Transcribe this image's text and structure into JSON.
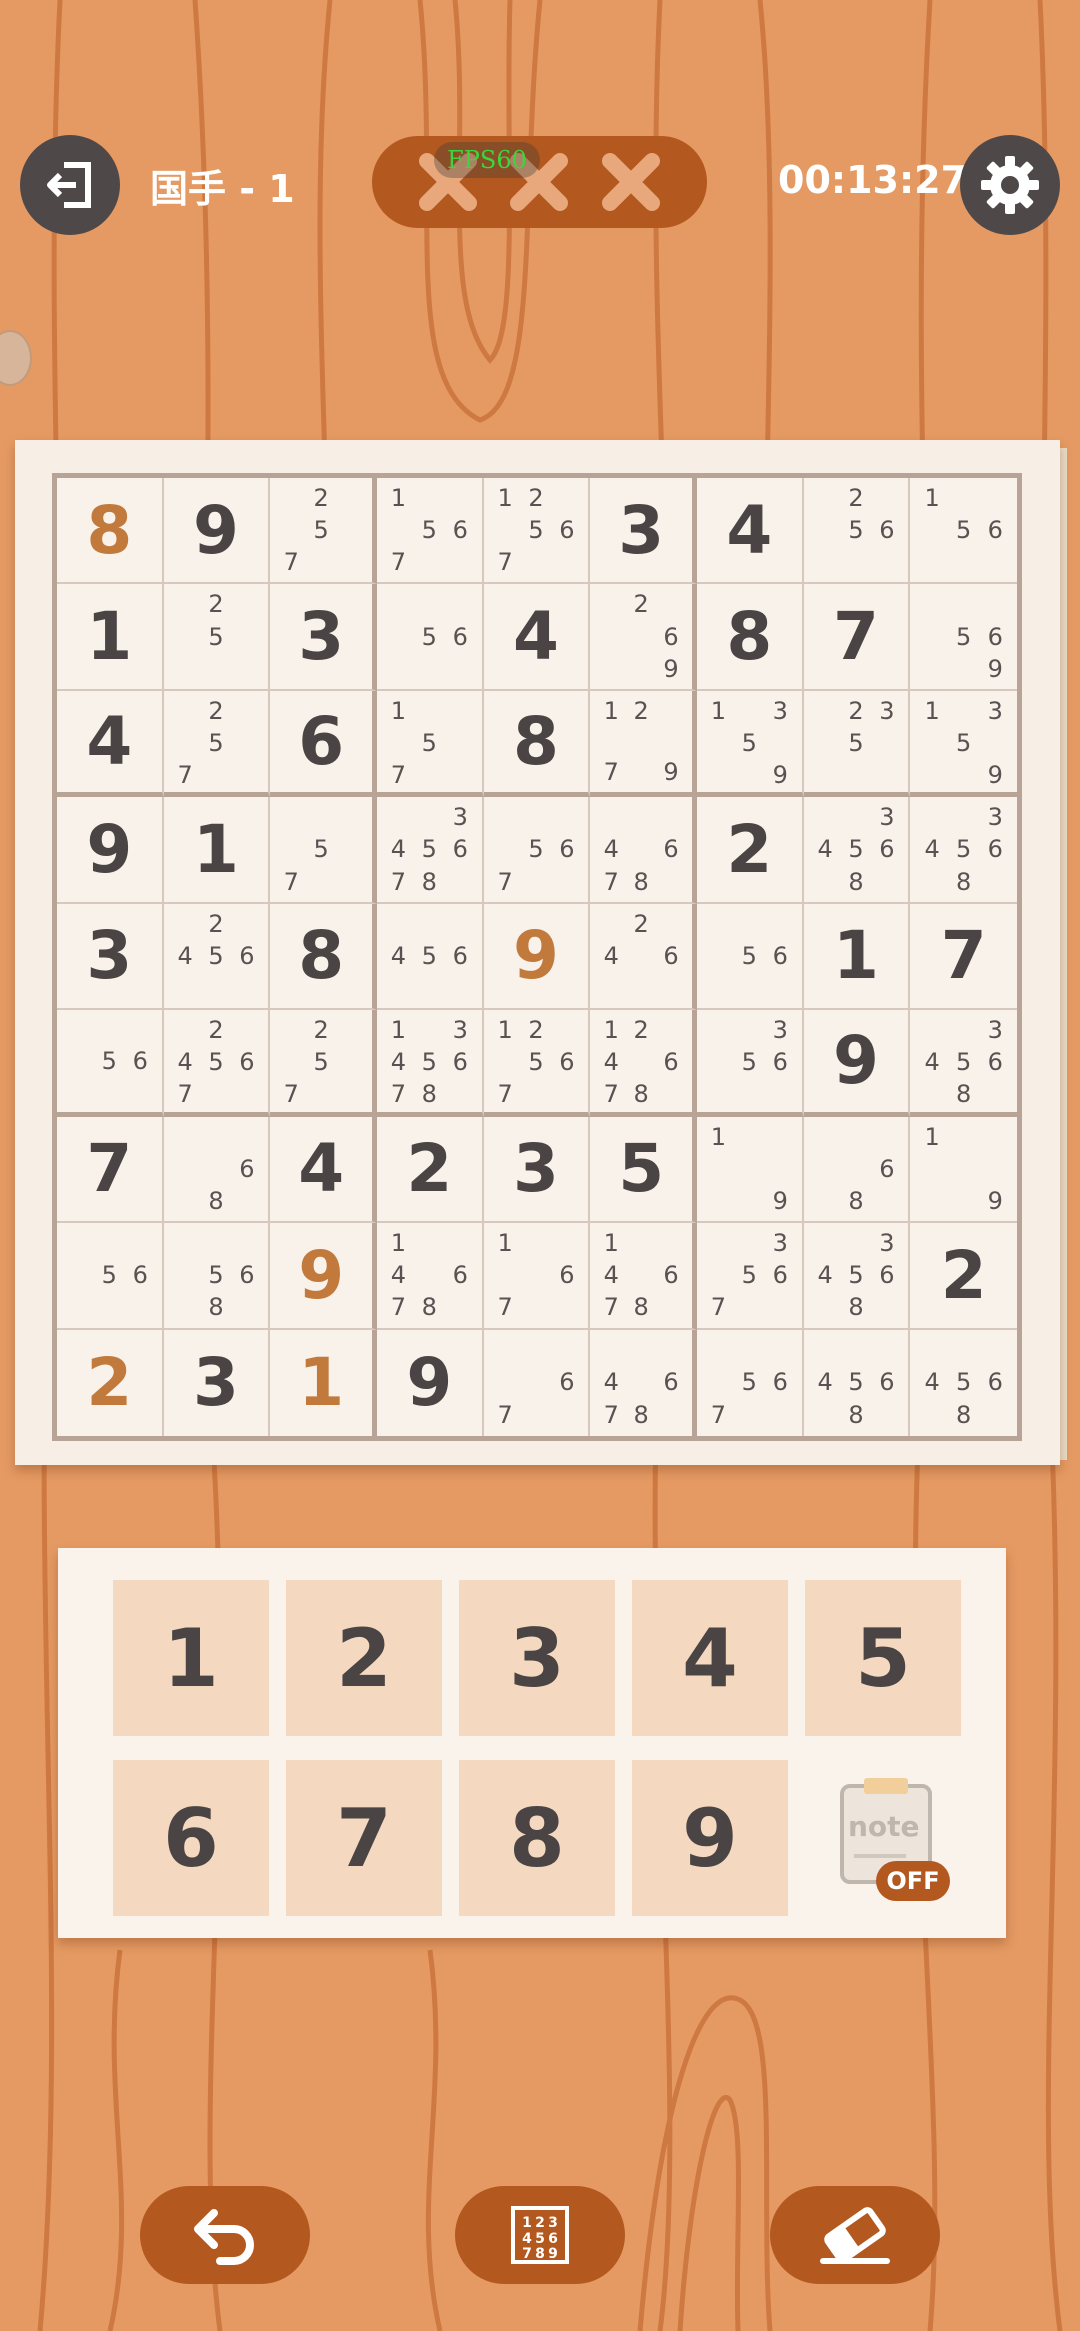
{
  "header": {
    "level": "国手 - 1",
    "timer": "00:13:27",
    "fps": "FPS60",
    "exit_icon": "exit-icon",
    "settings_icon": "gear-icon",
    "mistakes_icons": [
      "x-icon",
      "x-icon",
      "x-icon"
    ]
  },
  "board": {
    "cells": [
      [
        "8u",
        "9",
        "n:2,5,7",
        "n:1,5,6,7",
        "n:1,2,5,6,7",
        "3",
        "4",
        "n:2,5,6",
        "n:1,5,6"
      ],
      [
        "1",
        "n:2,5",
        "3",
        "n:5,6",
        "4",
        "n:2,6,9",
        "8",
        "7",
        "n:5,6,9"
      ],
      [
        "4",
        "n:2,5,7",
        "6",
        "n:1,5,7",
        "8",
        "n:1,2,7,9",
        "n:1,3,5,9",
        "n:2,3,5",
        "n:1,3,5,9"
      ],
      [
        "9",
        "1",
        "n:5,7",
        "n:3,4,5,6,7,8",
        "n:5,6,7",
        "n:4,6,7,8",
        "2",
        "n:3,4,5,6,8",
        "n:3,4,5,6,8"
      ],
      [
        "3",
        "n:2,4,5,6",
        "8",
        "n:4,5,6",
        "9u",
        "n:2,4,6",
        "n:5,6",
        "1",
        "7"
      ],
      [
        "n:5,6",
        "n:2,4,5,6,7",
        "n:2,5,7",
        "n:1,3,4,5,6,7,8",
        "n:1,2,5,6,7",
        "n:1,2,4,6,7,8",
        "n:3,5,6",
        "9",
        "n:3,4,5,6,8"
      ],
      [
        "7",
        "n:6,8",
        "4",
        "2",
        "3",
        "5",
        "n:1,9",
        "n:6,8",
        "n:1,9"
      ],
      [
        "n:5,6",
        "n:5,6,8",
        "9u",
        "n:1,4,6,7,8",
        "n:1,6,7",
        "n:1,4,6,7,8",
        "n:3,5,6,7",
        "n:3,4,5,6,8",
        "2"
      ],
      [
        "2u",
        "3",
        "1u",
        "9",
        "n:6,7",
        "n:4,6,7,8",
        "n:5,6,7",
        "n:4,5,6,8",
        "n:4,5,6,8"
      ]
    ]
  },
  "numpad": {
    "keys": [
      "1",
      "2",
      "3",
      "4",
      "5",
      "6",
      "7",
      "8",
      "9"
    ],
    "note_label": "note",
    "note_state": "OFF"
  },
  "bottom": {
    "undo_icon": "undo-icon",
    "notes_grid_icon": "number-grid-icon",
    "erase_icon": "eraser-icon"
  },
  "colors": {
    "background": "#e59a63",
    "accent": "#b3581e",
    "user_digit": "#c17a3c",
    "given_digit": "#4a4444"
  }
}
